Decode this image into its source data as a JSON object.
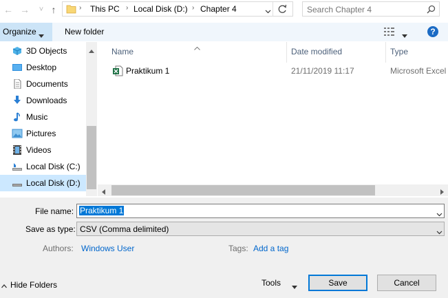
{
  "address": {
    "back_glyph": "←",
    "forward_glyph": "→",
    "recent_glyph": "˅",
    "up_glyph": "↑",
    "path": [
      "This PC",
      "Local Disk (D:)",
      "Chapter 4"
    ],
    "search_placeholder": "Search Chapter 4"
  },
  "toolbar": {
    "organize_label": "Organize",
    "new_folder_label": "New folder",
    "help_glyph": "?"
  },
  "sidebar": {
    "items": [
      {
        "label": "3D Objects",
        "icon": "3d-objects-icon"
      },
      {
        "label": "Desktop",
        "icon": "desktop-icon"
      },
      {
        "label": "Documents",
        "icon": "documents-icon"
      },
      {
        "label": "Downloads",
        "icon": "downloads-icon"
      },
      {
        "label": "Music",
        "icon": "music-icon"
      },
      {
        "label": "Pictures",
        "icon": "pictures-icon"
      },
      {
        "label": "Videos",
        "icon": "videos-icon"
      },
      {
        "label": "Local Disk (C:)",
        "icon": "drive-icon"
      },
      {
        "label": "Local Disk (D:)",
        "icon": "drive-icon",
        "selected": true
      }
    ]
  },
  "files": {
    "columns": [
      "Name",
      "Date modified",
      "Type"
    ],
    "rows": [
      {
        "name": "Praktikum 1",
        "date": "21/11/2019 11:17",
        "type": "Microsoft Excel",
        "icon": "excel-file-icon"
      }
    ]
  },
  "form": {
    "file_name_label": "File name:",
    "file_name_value": "Praktikum 1",
    "save_type_label": "Save as type:",
    "save_type_value": "CSV (Comma delimited)",
    "authors_label": "Authors:",
    "authors_value": "Windows User",
    "tags_label": "Tags:",
    "tags_value": "Add a tag"
  },
  "footer": {
    "hide_folders_label": "Hide Folders",
    "tools_label": "Tools",
    "save_label": "Save",
    "cancel_label": "Cancel"
  },
  "colors": {
    "accent": "#0078d7",
    "selection": "#cce8ff",
    "link": "#0066cc",
    "header_text": "#4c607a",
    "toolbar_bg": "#f0f6fc",
    "form_bg": "#f0f0f0"
  }
}
